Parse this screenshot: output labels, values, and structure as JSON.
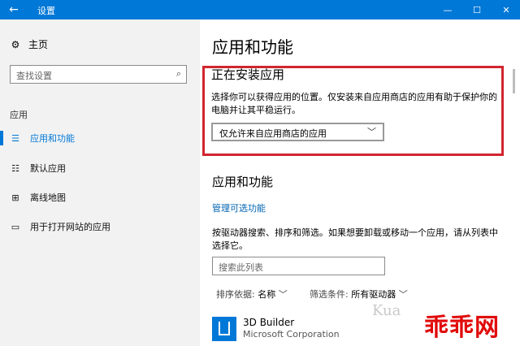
{
  "window": {
    "back_icon": "←",
    "title": "设置",
    "minimize_icon": "—",
    "maximize_icon": "☐",
    "close_icon": "✕"
  },
  "sidebar": {
    "home_icon": "⚙",
    "home_label": "主页",
    "search_placeholder": "查找设置",
    "search_icon": "⌕",
    "section_label": "应用",
    "items": [
      {
        "icon": "☰",
        "label": "应用和功能",
        "active": true
      },
      {
        "icon": "☷",
        "label": "默认应用",
        "active": false
      },
      {
        "icon": "⊞",
        "label": "离线地图",
        "active": false
      },
      {
        "icon": "▭",
        "label": "用于打开网站的应用",
        "active": false
      }
    ]
  },
  "main": {
    "page_title": "应用和功能",
    "install": {
      "title": "正在安装应用",
      "description": "选择你可以获得应用的位置。仅安装来自应用商店的应用有助于保护你的电脑并让其平稳运行。",
      "select_value": "仅允许来自应用商店的应用",
      "chevron": "﹀"
    },
    "apps": {
      "title": "应用和功能",
      "manage_link": "管理可选功能",
      "description": "按驱动器搜索、排序和筛选。如果想要卸载或移动一个应用，请从列表中选择它。",
      "search_placeholder": "搜索此列表",
      "sort_label": "排序依据:",
      "sort_value": "名称",
      "filter_label": "筛选条件:",
      "filter_value": "所有驱动器",
      "chevron": "﹀",
      "list": [
        {
          "name": "3D Builder",
          "publisher": "Microsoft Corporation"
        }
      ]
    }
  },
  "watermark": {
    "text": "Kua",
    "logo_text": "乖乖网"
  },
  "colors": {
    "accent": "#0078d7",
    "highlight_border": "#d0262f",
    "watermark_red": "#e10a0a"
  }
}
